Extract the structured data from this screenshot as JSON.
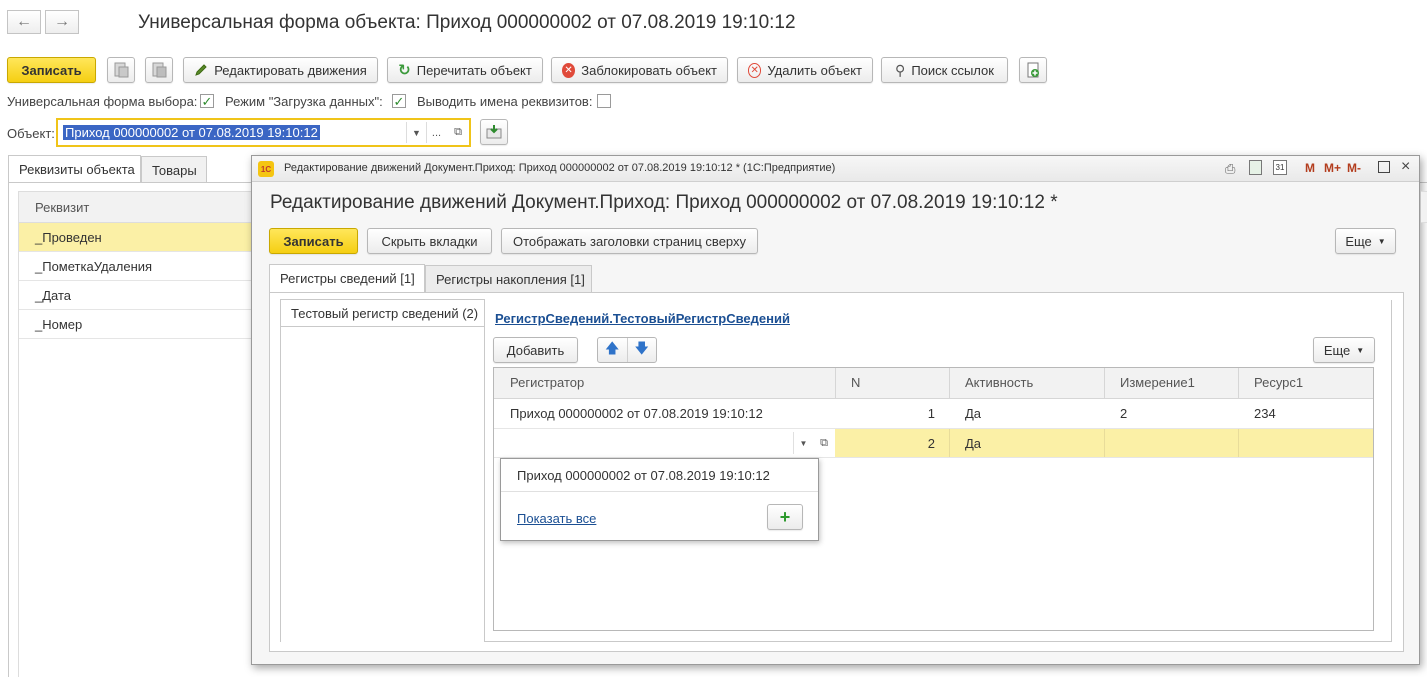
{
  "main": {
    "title": "Универсальная форма объекта: Приход 000000002 от 07.08.2019 19:10:12",
    "toolbar": {
      "save": "Записать",
      "edit_movements": "Редактировать движения",
      "reread": "Перечитать объект",
      "lock": "Заблокировать объект",
      "delete": "Удалить объект",
      "find_refs": "Поиск ссылок"
    },
    "options": {
      "universal_select_label": "Универсальная форма выбора:",
      "universal_select_checked": true,
      "load_mode_label": "Режим \"Загрузка данных\":",
      "load_mode_checked": true,
      "show_names_label": "Выводить имена реквизитов:",
      "show_names_checked": false
    },
    "object_label": "Объект:",
    "object_value": "Приход 000000002 от 07.08.2019 19:10:12",
    "tabs": [
      "Реквизиты объекта",
      "Товары"
    ],
    "attr_header": "Реквизит",
    "attributes": [
      "_Проведен",
      "_ПометкаУдаления",
      "_Дата",
      "_Номер"
    ]
  },
  "dialog": {
    "window_title": "Редактирование движений Документ.Приход: Приход 000000002 от 07.08.2019 19:10:12 * (1С:Предприятие)",
    "heading": "Редактирование движений Документ.Приход: Приход 000000002 от 07.08.2019 19:10:12 *",
    "save": "Записать",
    "hide_tabs": "Скрыть вкладки",
    "show_headers_top": "Отображать заголовки страниц сверху",
    "more": "Еще",
    "tabs": [
      "Регистры сведений [1]",
      "Регистры накопления [1]"
    ],
    "register_item": "Тестовый регистр сведений (2)",
    "register_link": "РегистрСведений.ТестовыйРегистрСведений",
    "add": "Добавить",
    "more2": "Еще",
    "columns": [
      "Регистратор",
      "N",
      "Активность",
      "Измерение1",
      "Ресурс1"
    ],
    "rows": [
      {
        "registrar": "Приход 000000002 от 07.08.2019 19:10:12",
        "n": "1",
        "active": "Да",
        "dim": "2",
        "res": "234"
      },
      {
        "registrar": "",
        "n": "2",
        "active": "Да",
        "dim": "",
        "res": ""
      }
    ],
    "dropdown_item": "Приход 000000002 от 07.08.2019 19:10:12",
    "show_all": "Показать все",
    "title_buttons": [
      "M",
      "M+",
      "M-"
    ],
    "colors": {
      "accent_yellow": "#f5cf12",
      "highlight_row": "#fbf0a6",
      "link": "#1b4f93"
    }
  }
}
